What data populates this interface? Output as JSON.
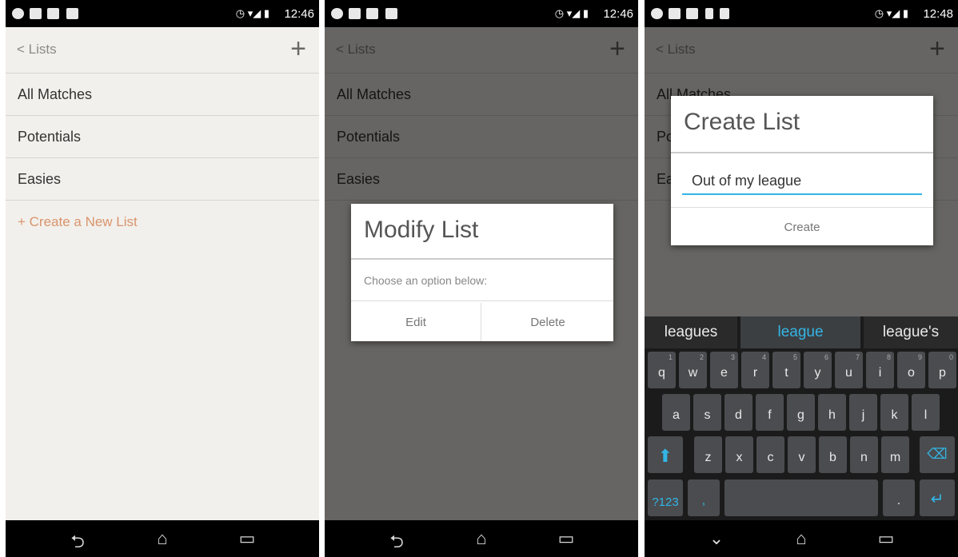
{
  "status": {
    "times": [
      "12:46",
      "12:46",
      "12:48"
    ]
  },
  "lists": {
    "back_label": "< Lists",
    "add_label": "+",
    "items": [
      "All Matches",
      "Potentials",
      "Easies"
    ],
    "create_label": "+ Create a New List"
  },
  "modify_dialog": {
    "title": "Modify List",
    "message": "Choose an option below:",
    "edit_label": "Edit",
    "delete_label": "Delete"
  },
  "create_dialog": {
    "title": "Create List",
    "input_value": "Out of my league",
    "create_label": "Create"
  },
  "keyboard": {
    "suggestions": [
      "leagues",
      "league",
      "league's"
    ],
    "row1": [
      "q",
      "w",
      "e",
      "r",
      "t",
      "y",
      "u",
      "i",
      "o",
      "p"
    ],
    "row1_alt": [
      "1",
      "2",
      "3",
      "4",
      "5",
      "6",
      "7",
      "8",
      "9",
      "0"
    ],
    "row2": [
      "a",
      "s",
      "d",
      "f",
      "g",
      "h",
      "j",
      "k",
      "l"
    ],
    "row3": [
      "z",
      "x",
      "c",
      "v",
      "b",
      "n",
      "m"
    ],
    "num_label": "?123",
    "comma_label": ","
  },
  "colors": {
    "accent": "#33b5e5",
    "create_link": "#d9946c",
    "overlay": "#000000"
  },
  "icons": {
    "back": "chevron-left-icon",
    "nav_back": "nav-back-icon",
    "home": "home-icon",
    "recents": "recents-icon"
  }
}
